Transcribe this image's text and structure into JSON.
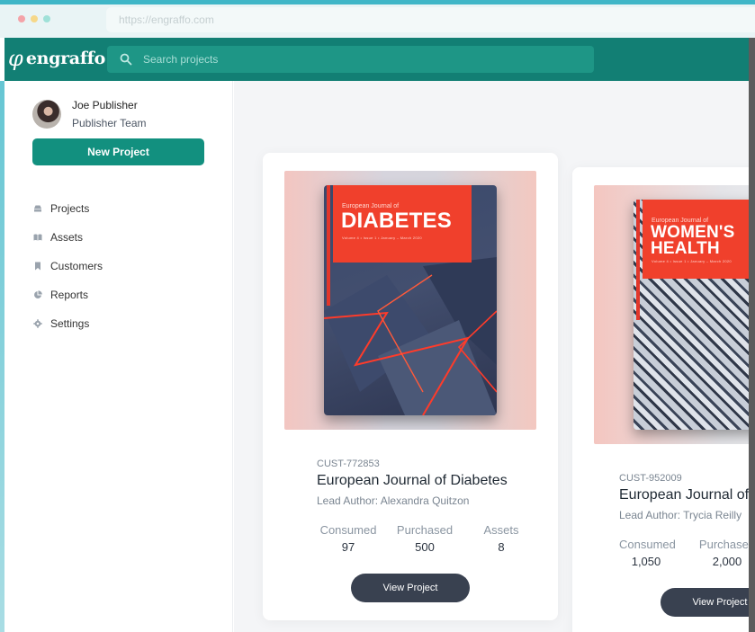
{
  "browser": {
    "url": "https://engraffo.com"
  },
  "header": {
    "brand_mark": "φ",
    "brand_name": "engraffo",
    "search_placeholder": "Search projects"
  },
  "sidebar": {
    "user_name": "Joe Publisher",
    "user_team": "Publisher Team",
    "new_project_label": "New Project",
    "items": [
      {
        "label": "Projects",
        "icon": "inbox-icon"
      },
      {
        "label": "Assets",
        "icon": "book-open-icon"
      },
      {
        "label": "Customers",
        "icon": "bookmark-icon"
      },
      {
        "label": "Reports",
        "icon": "pie-chart-icon"
      },
      {
        "label": "Settings",
        "icon": "gear-icon"
      }
    ]
  },
  "projects": [
    {
      "cover_small": "European Journal of",
      "cover_title": "DIABETES",
      "cover_meta": "Volume 4  •  Issue 1  •  January – March 2020",
      "customer_id": "CUST-772853",
      "journal": "European Journal of Diabetes",
      "lead_author": "Lead Author: Alexandra Quitzon",
      "stats": [
        {
          "label": "Consumed",
          "value": "97"
        },
        {
          "label": "Purchased",
          "value": "500"
        },
        {
          "label": "Assets",
          "value": "8"
        }
      ],
      "button_label": "View Project"
    },
    {
      "cover_small": "European Journal of",
      "cover_title_line1": "WOMEN'S",
      "cover_title_line2": "HEALTH",
      "cover_meta": "Volume 4  •  Issue 1  •  January – March 2020",
      "customer_id": "CUST-952009",
      "journal": "European Journal of Women's Health",
      "lead_author": "Lead Author: Trycia Reilly",
      "stats": [
        {
          "label": "Consumed",
          "value": "1,050"
        },
        {
          "label": "Purchased",
          "value": "2,000"
        }
      ],
      "button_label": "View Project"
    }
  ],
  "colors": {
    "brand_teal": "#127f74",
    "button_teal": "#12907f",
    "cover_red": "#f0402c",
    "dark_button": "#394150"
  }
}
